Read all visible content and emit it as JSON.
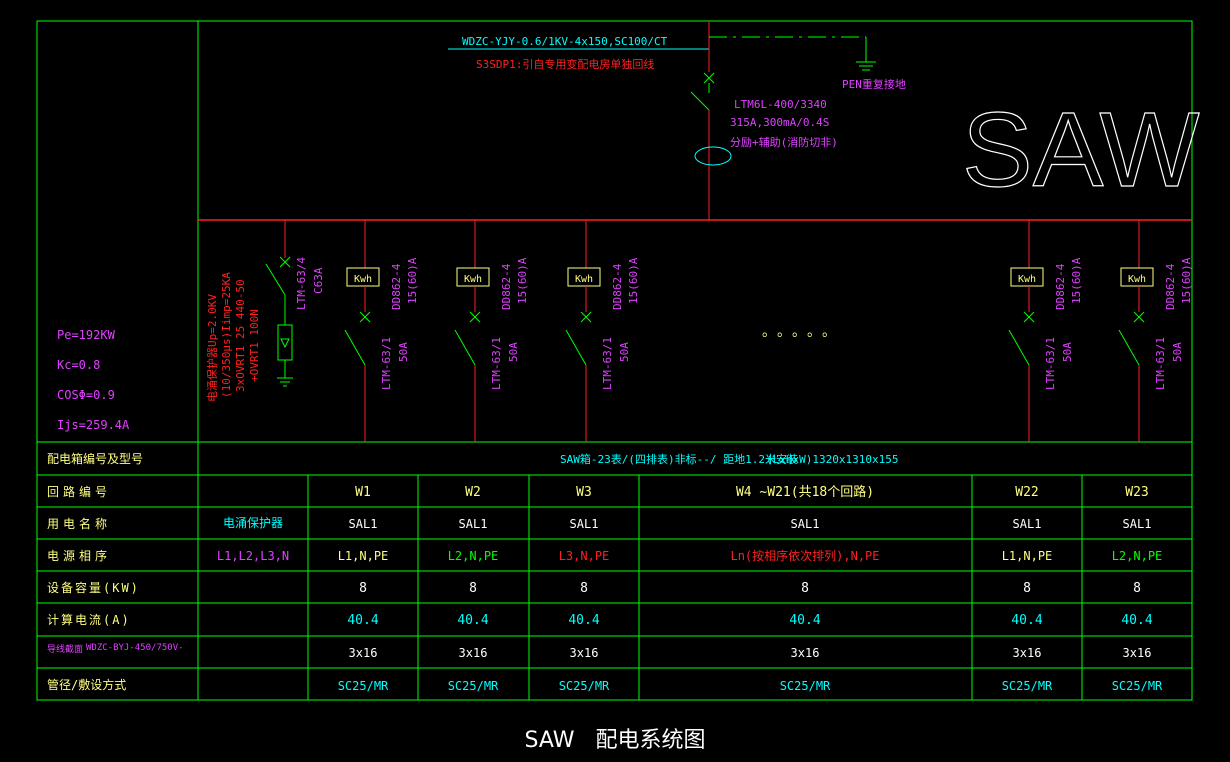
{
  "incoming": {
    "cable": "WDZC-YJY-0.6/1KV-4x150,SC100/CT",
    "source": "S3SDP1:引自专用变配电房单独回线",
    "pen": "PEN重复接地",
    "breaker_model": "LTM6L-400/3340",
    "breaker_spec": "315A,300mA/0.4S",
    "breaker_note": "分励+辅助(消防切非)"
  },
  "panel_name": "SAW",
  "calc": {
    "pe": "Pe=192KW",
    "kc": "Kc=0.8",
    "cos": "COSΦ=0.9",
    "ijs": "Ijs=259.4A"
  },
  "spd": {
    "breaker": "LTM-63/4",
    "rating": "C63A",
    "line1": "电涌保护器Up=2.0KV",
    "line2": "(10/350μs)Iimp=25KA",
    "line3": "3xOVRT1 25 440-50",
    "line4": "+OVRT1 100N"
  },
  "meter": {
    "label": "Kwh",
    "model": "DD862-4",
    "rating": "15(60)A"
  },
  "branch_breaker": {
    "model": "LTM-63/1",
    "rating": "50A"
  },
  "ellipsis": "。。。。。",
  "table": {
    "row_headers": [
      "配电箱编号及型号",
      "回路编号",
      "用电名称",
      "电源相序",
      "设备容量(KW)",
      "计算电流(A)",
      "导线截面",
      "管径/敷设方式"
    ],
    "cable_type": "WDZC-BYJ-450/750V-",
    "box_spec": "SAW箱-23表/(四排表)非标--/ 距地1.2米安装",
    "box_dims": "(LxHxW)1320x1310x155",
    "spd_col": {
      "name": "电涌保护器",
      "phase": "L1,L2,L3,N"
    },
    "columns": [
      {
        "circuit": "W1",
        "name": "SAL1",
        "phase": "L1,N,PE",
        "phase_color": "#ffff80",
        "power": "8",
        "current": "40.4",
        "section": "3x16",
        "conduit": "SC25/MR"
      },
      {
        "circuit": "W2",
        "name": "SAL1",
        "phase": "L2,N,PE",
        "phase_color": "#00ff00",
        "power": "8",
        "current": "40.4",
        "section": "3x16",
        "conduit": "SC25/MR"
      },
      {
        "circuit": "W3",
        "name": "SAL1",
        "phase": "L3,N,PE",
        "phase_color": "#ff2020",
        "power": "8",
        "current": "40.4",
        "section": "3x16",
        "conduit": "SC25/MR"
      },
      {
        "circuit": "W4 ~W21(共18个回路)",
        "name": "SAL1",
        "phase": "Ln(按相序依次排列),N,PE",
        "phase_color": "#ff2020",
        "power": "8",
        "current": "40.4",
        "section": "3x16",
        "conduit": "SC25/MR"
      },
      {
        "circuit": "W22",
        "name": "SAL1",
        "phase": "L1,N,PE",
        "phase_color": "#ffff80",
        "power": "8",
        "current": "40.4",
        "section": "3x16",
        "conduit": "SC25/MR"
      },
      {
        "circuit": "W23",
        "name": "SAL1",
        "phase": "L2,N,PE",
        "phase_color": "#00ff00",
        "power": "8",
        "current": "40.4",
        "section": "3x16",
        "conduit": "SC25/MR"
      }
    ]
  },
  "drawing_title": "SAW   配电系统图",
  "colors": {
    "frame": "#00ff00",
    "bus": "#ff2020",
    "magenta": "#e040ff",
    "cyan": "#00ffff",
    "yellow": "#ffff80",
    "white": "#ffffff"
  }
}
